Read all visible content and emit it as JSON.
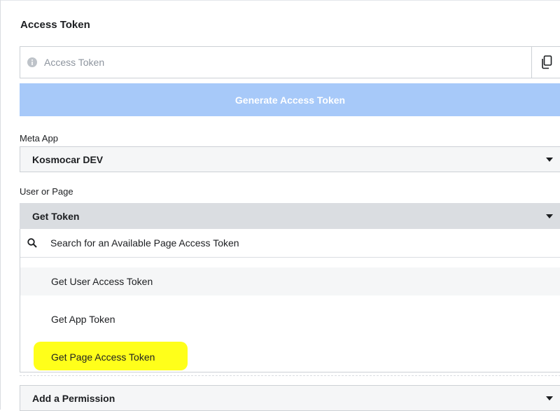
{
  "section_title": "Access Token",
  "token_field": {
    "placeholder": "Access Token",
    "value": ""
  },
  "generate_button": "Generate Access Token",
  "meta_app": {
    "label": "Meta App",
    "selected": "Kosmocar DEV"
  },
  "user_or_page": {
    "label": "User or Page",
    "selected": "Get Token",
    "search_placeholder": "Search for an Available Page Access Token",
    "options": [
      "Get User Access Token",
      "Get App Token",
      "Get Page Access Token"
    ]
  },
  "permission": {
    "selected": "Add a Permission"
  },
  "colors": {
    "generate_button_bg": "#a7c9f9",
    "highlight": "#ffff1a",
    "select_bg": "#f5f6f7",
    "select_open_bg": "#dadde1"
  },
  "icons": [
    "info-icon",
    "copy-icon",
    "chevron-down-icon",
    "search-icon"
  ]
}
